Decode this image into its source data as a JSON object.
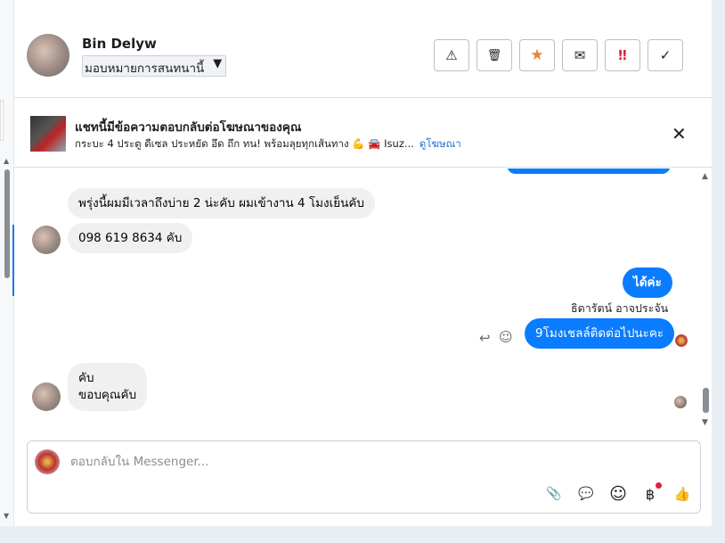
{
  "contact": {
    "name": "Bin Delyw",
    "assign_label": "มอบหมายการสนทนานี้"
  },
  "actions": [
    {
      "name": "spam-button",
      "icon": "warning-icon",
      "glyph": "⚠"
    },
    {
      "name": "delete-button",
      "icon": "trash-icon",
      "glyph": "🗑"
    },
    {
      "name": "star-button",
      "icon": "star-icon",
      "glyph": "★",
      "color": "#e8833a"
    },
    {
      "name": "mark-unread-button",
      "icon": "envelope-icon",
      "glyph": "✉"
    },
    {
      "name": "follow-up-button",
      "icon": "double-exclamation-icon",
      "glyph": "‼",
      "color": "#e41e3f"
    },
    {
      "name": "mark-done-button",
      "icon": "check-icon",
      "glyph": "✓"
    }
  ],
  "ad_banner": {
    "title": "แชทนี้มีข้อความตอบกลับต่อโฆษณาของคุณ",
    "description": "กระบะ 4 ประตู ดีเซล ประหยัด อึด ถึก ทน! พร้อมลุยทุกเส้นทาง 💪 🚘 Isuz...",
    "link": "ดูโฆษณา"
  },
  "messages": {
    "incoming_1": "พรุ่งนี้ผมมีเวลาถึงบ่าย 2 น่ะคับ ผมเข้างาน 4 โมงเย็นคับ",
    "incoming_2": "098 619 8634 คับ",
    "outgoing_1": "ได้ค่ะ",
    "sender_name": "ธิดารัตน์ อาจประจัน",
    "outgoing_2": "9โมงเชลล์ติดต่อไปนะคะ",
    "incoming_3_line1": "คับ",
    "incoming_3_line2": "ขอบคุณคับ"
  },
  "composer": {
    "placeholder": "ตอบกลับใน Messenger..."
  },
  "tools": [
    {
      "name": "attach-button",
      "icon": "paperclip-icon",
      "glyph": "📎"
    },
    {
      "name": "saved-replies-button",
      "icon": "chat-bubble-icon",
      "glyph": "💬"
    },
    {
      "name": "emoji-button",
      "icon": "smiley-icon",
      "glyph": "☺"
    },
    {
      "name": "payment-button",
      "icon": "baht-icon",
      "glyph": "฿"
    },
    {
      "name": "like-button",
      "icon": "thumbs-up-icon",
      "glyph": "👍"
    }
  ],
  "colors": {
    "accent": "#0a7cff",
    "link": "#216fdb",
    "incoming_bubble": "#f0f0f0"
  }
}
